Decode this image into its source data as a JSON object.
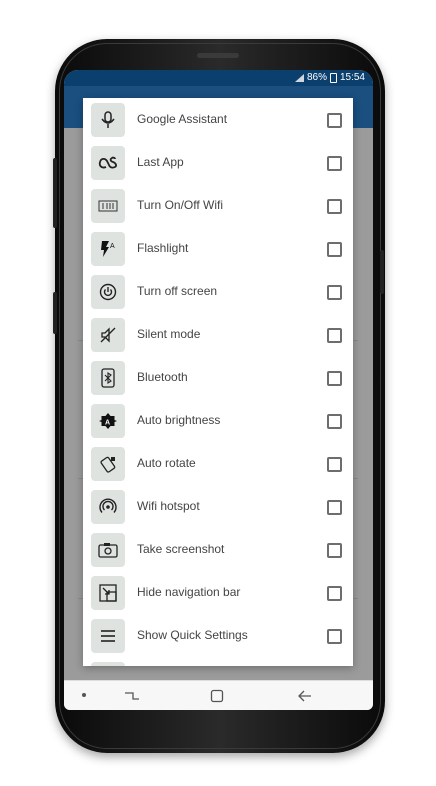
{
  "status_bar": {
    "battery_text": "86%",
    "time": "15:54"
  },
  "dialog": {
    "items": [
      {
        "label": "Google Assistant",
        "icon": "microphone-icon"
      },
      {
        "label": "Last App",
        "icon": "lastfm-icon"
      },
      {
        "label": "Turn On/Off Wifi",
        "icon": "wifi-toggle-icon"
      },
      {
        "label": "Flashlight",
        "icon": "flashlight-icon"
      },
      {
        "label": "Turn off screen",
        "icon": "power-icon"
      },
      {
        "label": "Silent mode",
        "icon": "silent-icon"
      },
      {
        "label": "Bluetooth",
        "icon": "bluetooth-icon"
      },
      {
        "label": "Auto brightness",
        "icon": "auto-brightness-icon"
      },
      {
        "label": "Auto rotate",
        "icon": "rotate-icon"
      },
      {
        "label": "Wifi hotspot",
        "icon": "hotspot-icon"
      },
      {
        "label": "Take screenshot",
        "icon": "camera-icon"
      },
      {
        "label": "Hide navigation bar",
        "icon": "hide-nav-icon"
      },
      {
        "label": "Show Quick Settings",
        "icon": "menu-icon"
      }
    ]
  },
  "nav_bar": {
    "buttons": [
      "recents-button",
      "home-button",
      "back-button"
    ]
  }
}
